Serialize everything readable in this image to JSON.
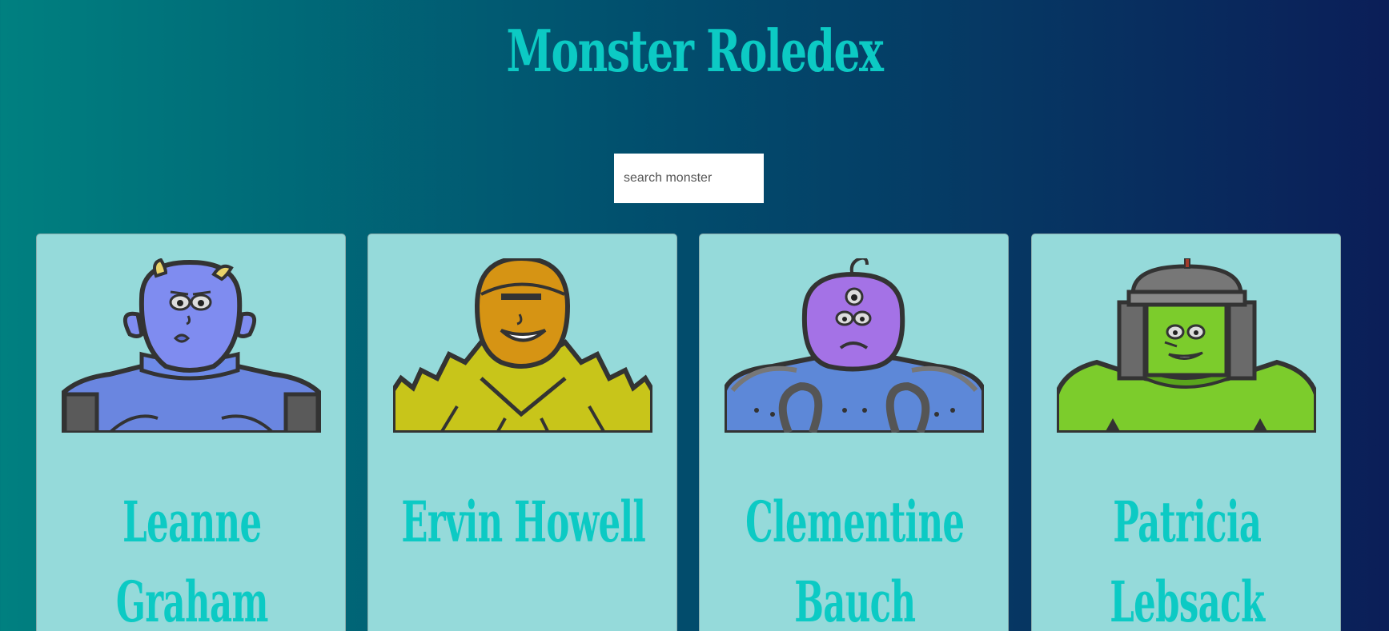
{
  "app": {
    "title": "Monster Roledex"
  },
  "search": {
    "placeholder": "search monster",
    "value": ""
  },
  "monsters": [
    {
      "name": "Leanne Graham",
      "icon": "blue-horned-monster-icon",
      "color": "#7f8cf0"
    },
    {
      "name": "Ervin Howell",
      "icon": "orange-spiky-monster-icon",
      "color": "#d69414"
    },
    {
      "name": "Clementine Bauch",
      "icon": "purple-cyclops-robot-monster-icon",
      "color": "#a472e6"
    },
    {
      "name": "Patricia Lebsack",
      "icon": "green-helmet-monster-icon",
      "color": "#7ccc2c"
    }
  ],
  "colors": {
    "title": "#0ccac4",
    "card_background": "#95dada",
    "gradient_start": "#008080",
    "gradient_end": "#0b1e58"
  }
}
